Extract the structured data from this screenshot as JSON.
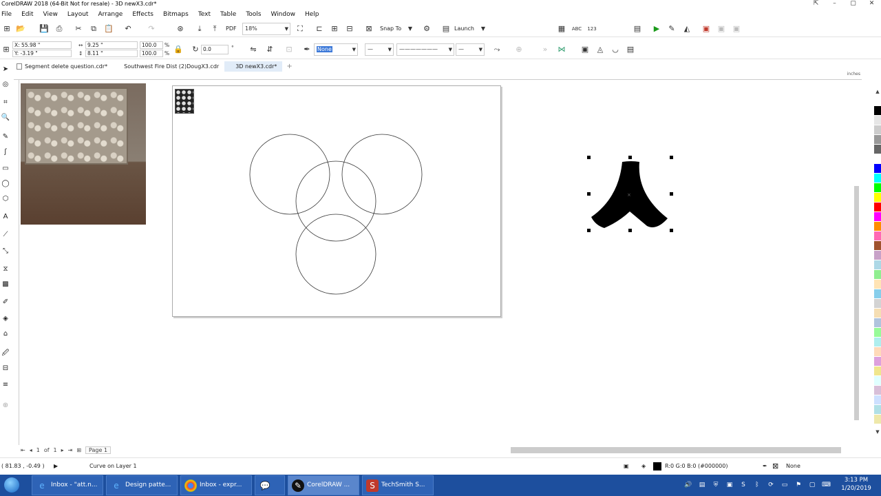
{
  "window": {
    "title": "CorelDRAW 2018 (64-Bit Not for resale) - 3D newX3.cdr*"
  },
  "menu": [
    "File",
    "Edit",
    "View",
    "Layout",
    "Arrange",
    "Effects",
    "Bitmaps",
    "Text",
    "Table",
    "Tools",
    "Window",
    "Help"
  ],
  "standard_toolbar": {
    "zoom": "18%",
    "snap_to": "Snap To",
    "launch": "Launch"
  },
  "property_bar": {
    "x": "X: 55.98 \"",
    "y": "Y: -3.19 \"",
    "width": "9.25 \"",
    "height": "8.11 \"",
    "scale_w": "100.0",
    "scale_h": "100.0",
    "percent": "%",
    "rotation": "0.0",
    "outline_width": "None"
  },
  "doc_tabs": [
    {
      "label": "Segment delete question.cdr*",
      "active": false
    },
    {
      "label": "Southwest Fire Dist (2)DougX3.cdr",
      "active": false
    },
    {
      "label": "3D newX3.cdr*",
      "active": true
    }
  ],
  "ruler": {
    "unit": "inches"
  },
  "page_nav": {
    "current": "1",
    "of_label": "of",
    "total": "1",
    "page_tab": "Page 1"
  },
  "status": {
    "cursor": "( 81.83 , -0.49 )",
    "object": "Curve on Layer 1",
    "fill": "R:0 G:0 B:0 (#000000)",
    "outline": "None"
  },
  "palette_colors": [
    "#ffffff",
    "#000000",
    "#e6e6e6",
    "#cccccc",
    "#999999",
    "#666666",
    "#ffffff",
    "#0000ff",
    "#00ffff",
    "#00ff00",
    "#ffff00",
    "#ff0000",
    "#ff00ff",
    "#ff8c00",
    "#ff69b4",
    "#a0522d",
    "#c8a2c8",
    "#add8e6",
    "#90ee90",
    "#ffe4b5",
    "#87ceeb",
    "#d3d3d3",
    "#f5deb3",
    "#b0c4de",
    "#98fb98",
    "#afeeee",
    "#ffdab9",
    "#dda0dd",
    "#f0e68c",
    "#e0ffff",
    "#d8bfd8",
    "#cde0ff",
    "#b0e0e6",
    "#eee8aa"
  ],
  "taskbar": {
    "items": [
      {
        "label": "Inbox - \"att.n...",
        "icon": "ie-icon",
        "active": false
      },
      {
        "label": "Design patte...",
        "icon": "ie-icon",
        "active": false
      },
      {
        "label": "Inbox - expr...",
        "icon": "chrome-icon",
        "active": false
      },
      {
        "label": "",
        "icon": "messenger-icon",
        "active": false
      },
      {
        "label": "CorelDRAW ...",
        "icon": "coreldraw-icon",
        "active": true
      },
      {
        "label": "TechSmith S...",
        "icon": "snagit-icon",
        "active": false
      }
    ],
    "time": "3:13 PM",
    "date": "1/20/2019"
  }
}
